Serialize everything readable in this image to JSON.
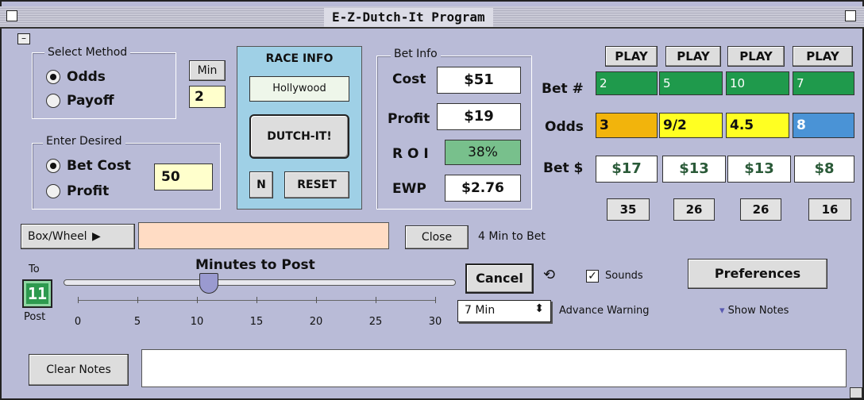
{
  "window": {
    "title": "E-Z-Dutch-It Program",
    "collapse_glyph": "–"
  },
  "select_method": {
    "label": "Select Method",
    "options": [
      "Odds",
      "Payoff"
    ],
    "selected": "Odds"
  },
  "min": {
    "label": "Min",
    "value": "2"
  },
  "race_info": {
    "label": "RACE INFO",
    "track": "Hollywood",
    "dutch_button": "DUTCH-IT!",
    "n_button": "N",
    "reset_button": "RESET"
  },
  "enter_desired": {
    "label": "Enter Desired",
    "options": [
      "Bet Cost",
      "Profit"
    ],
    "selected": "Bet Cost",
    "value": "50"
  },
  "bet_info": {
    "label": "Bet Info",
    "cost_label": "Cost",
    "cost": "$51",
    "profit_label": "Profit",
    "profit": "$19",
    "roi_label": "R O I",
    "roi": "38%",
    "ewp_label": "EWP",
    "ewp": "$2.76"
  },
  "grid": {
    "play_label": "PLAY",
    "bet_label": "Bet #",
    "odds_label": "Odds",
    "betamt_label": "Bet $",
    "bets": [
      "2",
      "5",
      "10",
      "7"
    ],
    "bet_color": "#1f9a4c",
    "odds": [
      "3",
      "9/2",
      "4.5",
      "8"
    ],
    "odds_colors": [
      "#f2b40c",
      "#ffff22",
      "#ffff22",
      "#4a93d6"
    ],
    "amounts": [
      "$17",
      "$13",
      "$13",
      "$8"
    ],
    "counts": [
      "35",
      "26",
      "26",
      "16"
    ]
  },
  "box_wheel": {
    "label": "Box/Wheel",
    "value": "",
    "close_button": "Close",
    "message": "4 Min to Bet"
  },
  "timer": {
    "to_label": "To",
    "value": "11",
    "post_label": "Post"
  },
  "slider": {
    "label": "Minutes to Post",
    "value": 11,
    "max": 30,
    "ticks": [
      "0",
      "5",
      "10",
      "15",
      "20",
      "25",
      "30"
    ]
  },
  "controls": {
    "cancel": "Cancel",
    "refresh_glyph": "⟲",
    "sounds_label": "Sounds",
    "sounds_checked": true,
    "preferences": "Preferences",
    "warning_select": "7 Min",
    "warning_label": "Advance Warning",
    "show_notes": "Show Notes"
  },
  "notes": {
    "clear_button": "Clear Notes",
    "value": ""
  }
}
